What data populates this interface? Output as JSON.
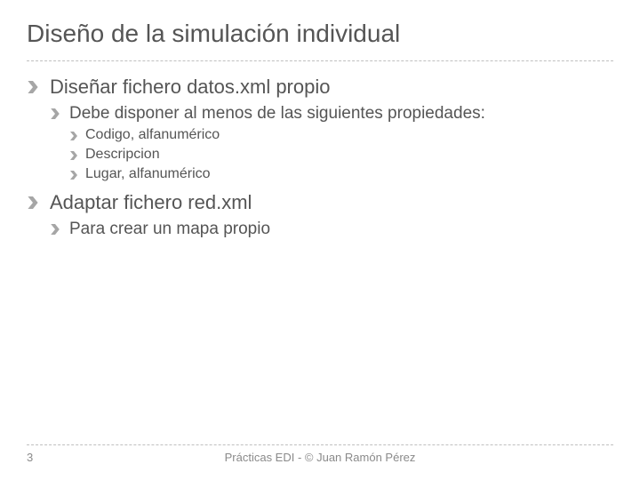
{
  "title": "Diseño de la simulación individual",
  "items": [
    {
      "text": "Diseñar fichero datos.xml propio",
      "children": [
        {
          "text": "Debe disponer al menos de las siguientes propiedades:",
          "children": [
            {
              "text": "Codigo, alfanumérico"
            },
            {
              "text": "Descripcion"
            },
            {
              "text": "Lugar, alfanumérico"
            }
          ]
        }
      ]
    },
    {
      "text": "Adaptar fichero red.xml",
      "children": [
        {
          "text": "Para crear un mapa propio"
        }
      ]
    }
  ],
  "footer": {
    "page": "3",
    "center": "Prácticas EDI - © Juan Ramón Pérez"
  },
  "colors": {
    "bullet": "#a6a6a6",
    "rule": "#bfbfbf",
    "text": "#555555",
    "footer": "#8a8a8a"
  }
}
